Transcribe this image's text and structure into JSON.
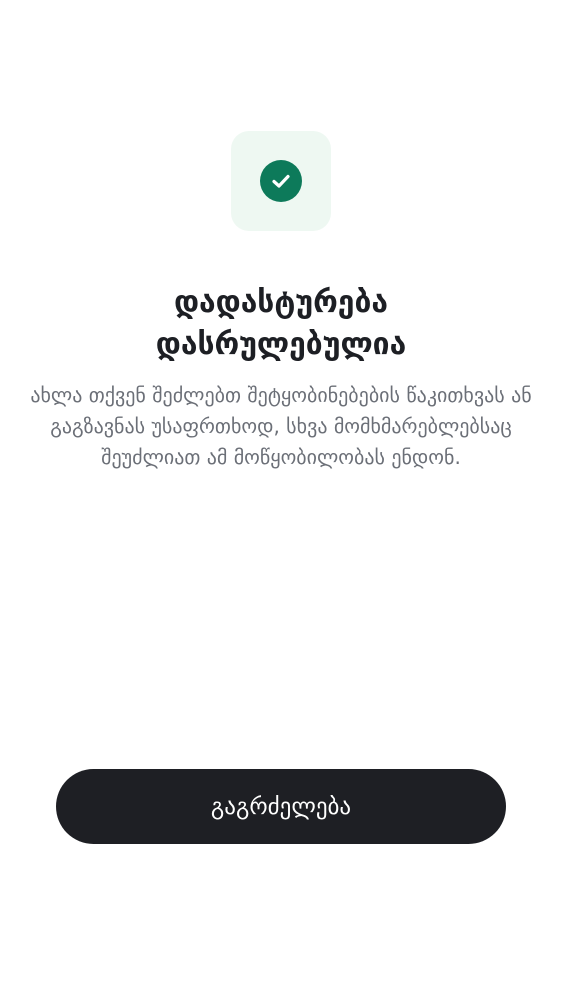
{
  "colors": {
    "accent": "#0d7a5a",
    "icon_tile_background": "#eef8f2",
    "button_background": "#1e1f24",
    "title_text": "#1d1f24",
    "body_text": "#6b6f77"
  },
  "success_icon": {
    "icon": "check-circle-icon"
  },
  "title": {
    "line1": "დადასტურება",
    "line2": "დასრულებულია"
  },
  "description": "ახლა თქვენ შეძლებთ შეტყობინებების წაკითხვას ან გაგზავნას უსაფრთხოდ, სხვა მომხმარებლებსაც შეუძლიათ ამ მოწყობილობას ენდონ.",
  "continue_button": {
    "label": "გაგრძელება"
  }
}
